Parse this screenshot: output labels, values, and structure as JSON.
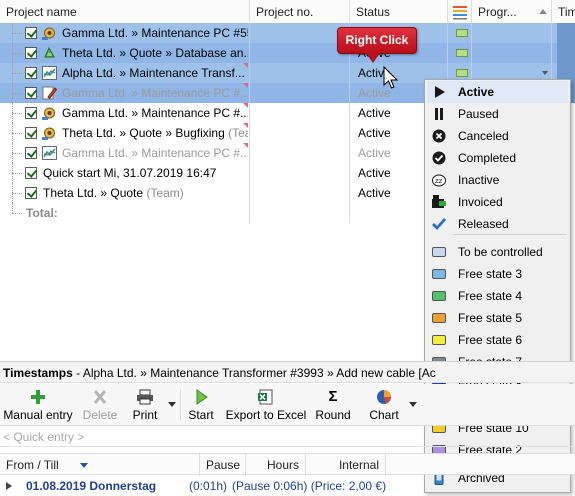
{
  "grid": {
    "columns": {
      "project_name": "Project name",
      "project_no": "Project no.",
      "status": "Status",
      "progress": "Progr...",
      "time": "Tim"
    },
    "rows": [
      {
        "text": "Gamma Ltd. » Maintenance PC #5556",
        "team": "",
        "status": "Active",
        "state": "selected",
        "icon": "gear-icon",
        "grey": false
      },
      {
        "text": "Theta Ltd. » Quote » Database an...",
        "team": "",
        "status": "Active",
        "state": "selected",
        "icon": "recycle-icon",
        "grey": false
      },
      {
        "text": "Alpha Ltd. » Maintenance Transf...",
        "team": "",
        "status": "Active",
        "state": "selected",
        "icon": "chart-icon",
        "grey": false
      },
      {
        "text": "Gamma Ltd. » Maintenance PC #...",
        "team": "",
        "status": "Active",
        "state": "selected",
        "icon": "pencil-icon",
        "grey": true
      },
      {
        "text": "Gamma Ltd. » Maintenance PC #...",
        "team": "",
        "status": "Active",
        "state": "normal",
        "icon": "gear-icon",
        "grey": false
      },
      {
        "text": "Theta Ltd. » Quote » Bugfixing",
        "team": "(Tea",
        "status": "Active",
        "state": "normal",
        "icon": "gear-icon",
        "grey": false
      },
      {
        "text": "Gamma Ltd. » Maintenance PC #...",
        "team": "",
        "status": "Active",
        "state": "normal",
        "icon": "chart-icon",
        "grey": true
      },
      {
        "text": "Quick start Mi, 31.07.2019 16:47",
        "team": "",
        "status": "Active",
        "state": "normal",
        "icon": "",
        "grey": false
      },
      {
        "text": "Theta Ltd. » Quote",
        "team": "(Team)",
        "status": "Active",
        "state": "normal",
        "icon": "",
        "grey": false
      }
    ],
    "total_label": "Total:"
  },
  "callout": {
    "text": "Right Click"
  },
  "context_menu": {
    "items": [
      {
        "label": "Active",
        "icon": "play-icon",
        "highlighted": true
      },
      {
        "label": "Paused",
        "icon": "pause-icon"
      },
      {
        "label": "Canceled",
        "icon": "cancel-icon"
      },
      {
        "label": "Completed",
        "icon": "check-circle-icon"
      },
      {
        "label": "Inactive",
        "icon": "sleep-icon"
      },
      {
        "label": "Invoiced",
        "icon": "invoice-icon"
      },
      {
        "label": "Released",
        "icon": "checkmark-icon"
      }
    ],
    "states": [
      {
        "label": "To be controlled",
        "color": "#c7d8ef"
      },
      {
        "label": "Free state 3",
        "color": "#7db9e8"
      },
      {
        "label": "Free state 4",
        "color": "#55bf6a"
      },
      {
        "label": "Free state 5",
        "color": "#f0a030"
      },
      {
        "label": "Free state 6",
        "color": "#f2ec3c"
      },
      {
        "label": "Free state 7",
        "color": "#7e8c92"
      },
      {
        "label": "Free state 8",
        "color": "#2233cc"
      },
      {
        "label": "Free state 9",
        "color": "#22cc22"
      },
      {
        "label": "Free state 10",
        "color": "#f2cc28"
      },
      {
        "label": "Free state 2",
        "color": "#b28ee0"
      }
    ],
    "archived_label": "Archived"
  },
  "timestamps": {
    "title": "Timestamps",
    "path": " - Alpha Ltd. » Maintenance Transformer #3993 » Add new cable [Ac",
    "toolbar": {
      "manual_entry": "Manual entry",
      "delete": "Delete",
      "print": "Print",
      "start": "Start",
      "export_excel": "Export to Excel",
      "round": "Round",
      "chart": "Chart"
    },
    "quick_entry_placeholder": "< Quick entry >",
    "columns": {
      "from_till": "From / Till",
      "pause": "Pause",
      "hours": "Hours",
      "internal": "Internal"
    },
    "first_row": {
      "date": "01.08.2019 Donnerstag",
      "details": "(Pause 0:06h) (Price: 2,00 €)",
      "hours_prefix": "(0:01h)"
    }
  },
  "colors": {
    "selection": "#9ec1ea",
    "callout": "#cc1f2b",
    "menu_highlight": "#dfe9f6"
  }
}
